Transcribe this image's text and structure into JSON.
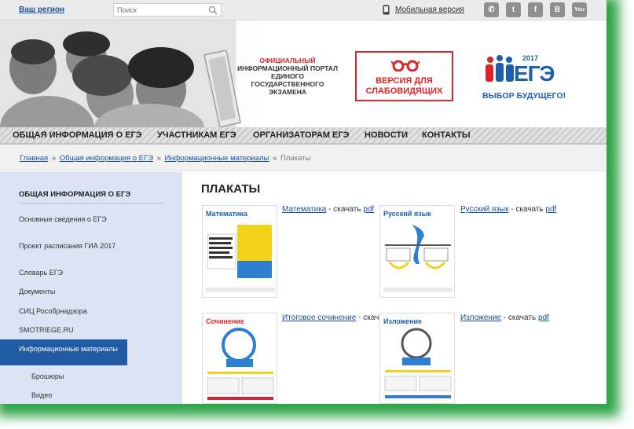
{
  "topbar": {
    "region": "Ваш регион",
    "search_placeholder": "Поиск",
    "mobile": "Мобильная версия",
    "social": [
      "✆",
      "t",
      "f",
      "B",
      "You"
    ]
  },
  "header": {
    "portal_title_line1": "ОФИЦИАЛЬНЫЙ",
    "portal_title_line2": "ИНФОРМАЦИОННЫЙ ПОРТАЛ",
    "portal_title_line3": "ЕДИНОГО ГОСУДАРСТВЕННОГО",
    "portal_title_line4": "ЭКЗАМЕНА",
    "impaired_line1": "ВЕРСИЯ ДЛЯ",
    "impaired_line2": "СЛАБОВИДЯЩИХ",
    "logo_year": "2017",
    "logo_text": "ЕГЭ",
    "logo_slogan": "ВЫБОР БУДУЩЕГО!",
    "brand_blue": "#1d5fa8",
    "brand_red": "#d9262a"
  },
  "nav": {
    "items": [
      "ОБЩАЯ ИНФОРМАЦИЯ О ЕГЭ",
      "УЧАСТНИКАМ ЕГЭ",
      "ОРГАНИЗАТОРАМ ЕГЭ",
      "НОВОСТИ",
      "КОНТАКТЫ"
    ]
  },
  "breadcrumb": {
    "home": "Главная",
    "section": "Общая информация о ЕГЭ",
    "subsection": "Информационные материалы",
    "current": "Плакаты",
    "sep": "»"
  },
  "sidebar": {
    "title": "ОБЩАЯ ИНФОРМАЦИЯ О ЕГЭ",
    "items": [
      "Основные сведения о ЕГЭ",
      "Проект расписания ГИА 2017",
      "Словарь ЕГЭ",
      "Документы",
      "СИЦ Рособрнадзора",
      "SMOTRIEGE.RU",
      "Информационные материалы"
    ],
    "subitems": [
      "Брошюры",
      "Видео"
    ],
    "active_color": "#1f5aa3"
  },
  "main": {
    "title": "ПЛАКАТЫ",
    "download": "- скачать",
    "pdf": "pdf",
    "posters": [
      {
        "name": "Математика",
        "thumb_title": "Математика",
        "accent": "#f3d21a"
      },
      {
        "name": "Русский язык",
        "thumb_title": "Русский язык",
        "accent": "#2f7fd1"
      },
      {
        "name": "Итоговое сочинение",
        "thumb_title": "Сочинение",
        "accent": "#d9262a"
      },
      {
        "name": "Изложение",
        "thumb_title": "Изложение",
        "accent": "#1d5fa8"
      }
    ]
  }
}
